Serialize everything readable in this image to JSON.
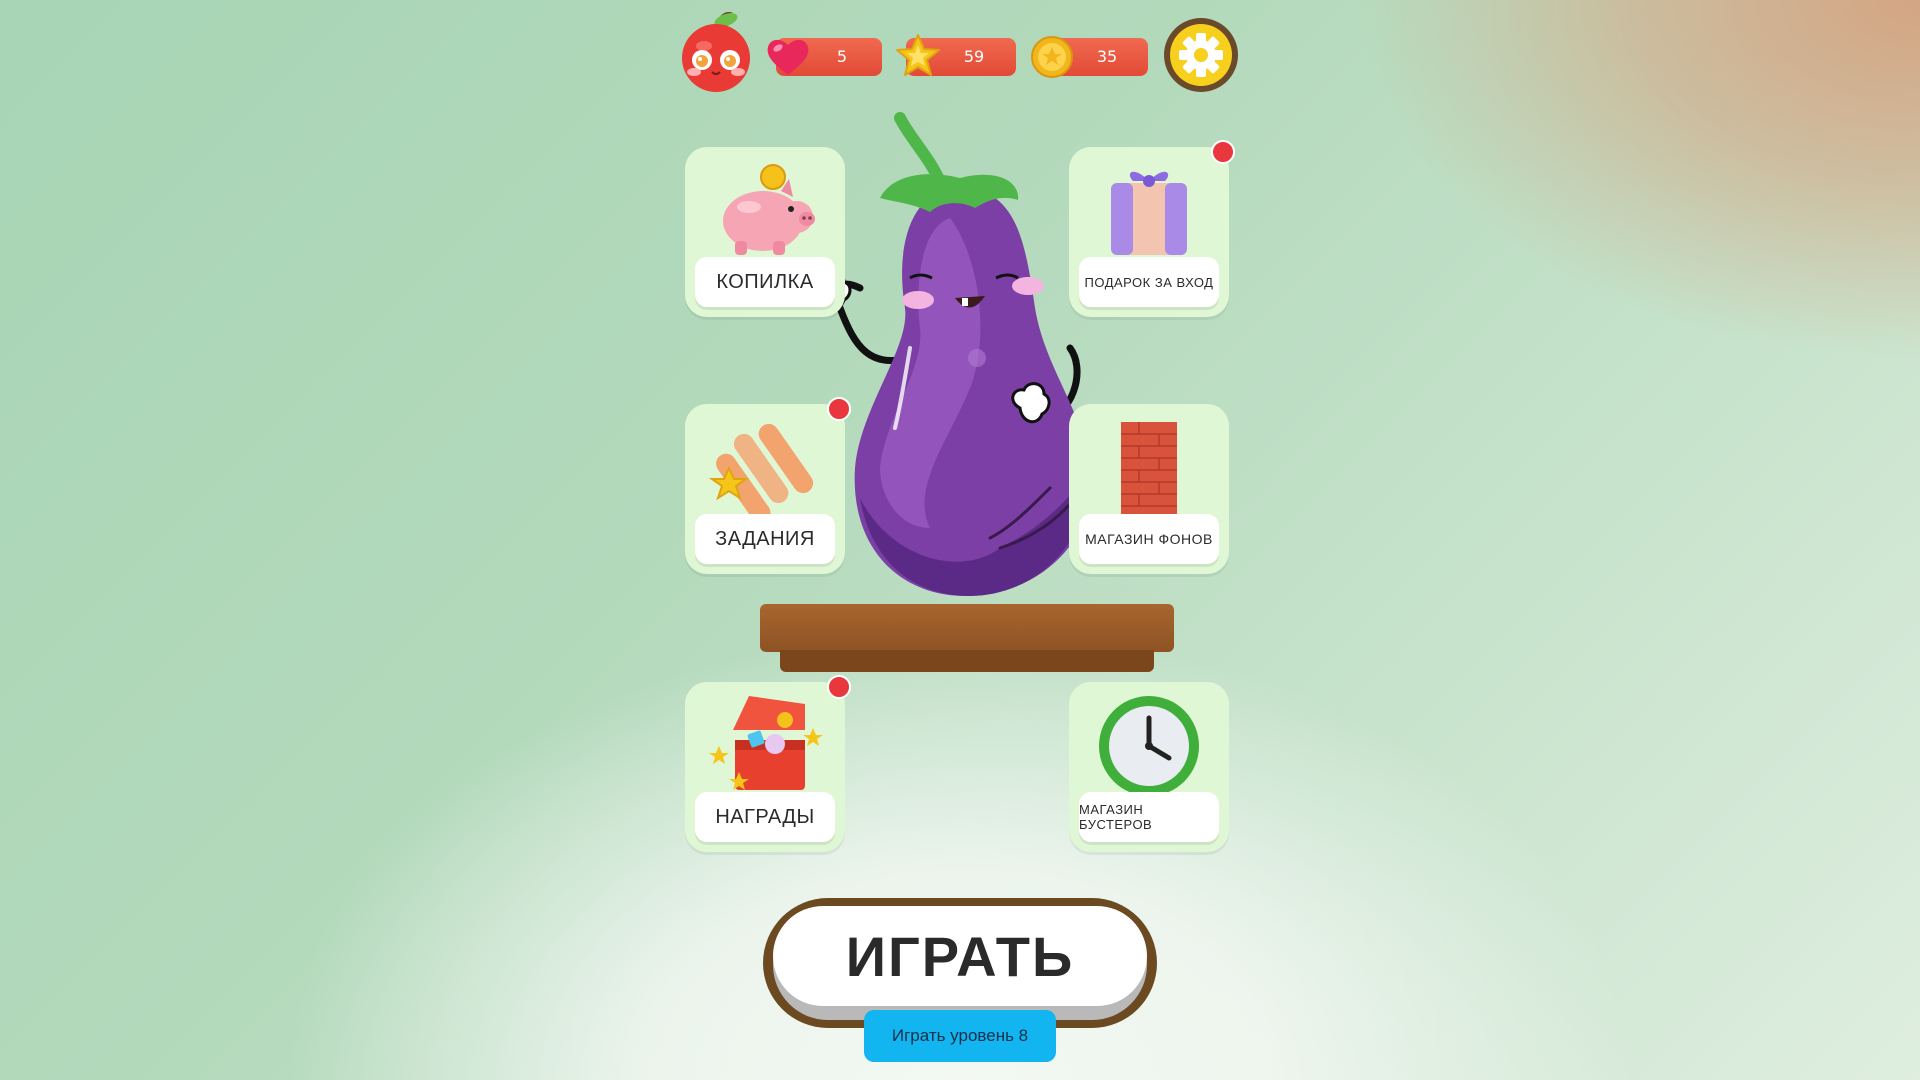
{
  "hud": {
    "lives": "5",
    "stars": "59",
    "coins": "35",
    "icons": [
      "apple-avatar-icon",
      "heart-icon",
      "star-icon",
      "coin-icon",
      "gear-icon"
    ]
  },
  "menu": {
    "piggy_bank": "КОПИЛКА",
    "login_gift": "ПОДАРОК ЗА ВХОД",
    "tasks": "ЗАДАНИЯ",
    "backgrounds_shop": "МАГАЗИН ФОНОВ",
    "rewards": "НАГРАДЫ",
    "boosters_shop": "МАГАЗИН БУСТЕРОВ"
  },
  "play": {
    "label": "ИГРАТЬ",
    "level_label": "Играть уровень 8"
  },
  "colors": {
    "pill": "#e24a36",
    "notification": "#e8383d",
    "card": "#dff7d4",
    "level_button": "#12b5ef",
    "gear": "#f7cf1d"
  }
}
